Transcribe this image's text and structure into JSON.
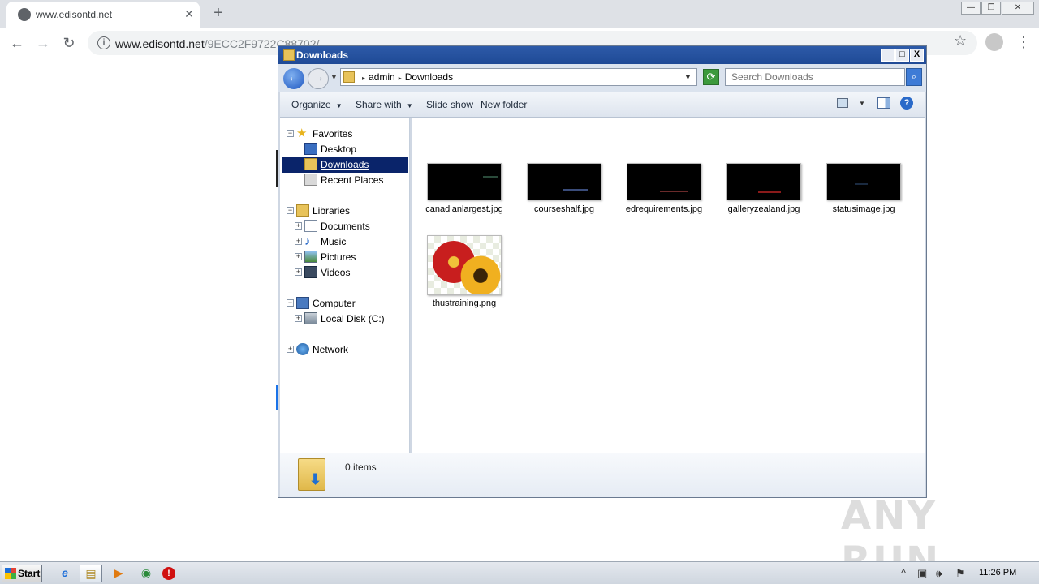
{
  "browser": {
    "tab_title": "www.edisontd.net",
    "tab_close": "✕",
    "new_tab": "+",
    "url_host": "www.edisontd.net",
    "url_path": "/9ECC2F9722C88702/",
    "win_minimize": "—",
    "win_restore": "❐",
    "win_close": "✕"
  },
  "explorer": {
    "title": "Downloads",
    "caption_min": "_",
    "caption_max": "□",
    "caption_close": "X",
    "breadcrumb": [
      "admin",
      "Downloads"
    ],
    "search_placeholder": "Search Downloads",
    "toolbar": {
      "organize": "Organize",
      "share_with": "Share with",
      "slide_show": "Slide show",
      "new_folder": "New folder",
      "help": "?"
    },
    "nav": {
      "favorites": "Favorites",
      "desktop": "Desktop",
      "downloads": "Downloads",
      "recent_places": "Recent Places",
      "libraries": "Libraries",
      "documents": "Documents",
      "music": "Music",
      "pictures": "Pictures",
      "videos": "Videos",
      "computer": "Computer",
      "local_disk": "Local Disk (C:)",
      "network": "Network"
    },
    "files": [
      {
        "name": "canadianlargest.jpg",
        "mark_color": "#2a4a3a"
      },
      {
        "name": "courseshalf.jpg",
        "mark_color": "#3a4c7a"
      },
      {
        "name": "edrequirements.jpg",
        "mark_color": "#6a2a2a"
      },
      {
        "name": "galleryzealand.jpg",
        "mark_color": "#8a1a1a"
      },
      {
        "name": "statusimage.jpg",
        "mark_color": "#1a2a40"
      },
      {
        "name": "thustraining.png",
        "type": "image-flower"
      }
    ],
    "status": "0 items"
  },
  "watermark": "ANY RUN",
  "taskbar": {
    "start_label": "Start",
    "clock": "11:26 PM",
    "ie_icon": "e",
    "explorer_icon": "▤",
    "media_icon": "▶",
    "chrome_icon": "◉",
    "stop_icon": "!",
    "tray_chevron": "^",
    "tray_network": "▣",
    "tray_volume": "🕪",
    "tray_flag": "⚑"
  }
}
